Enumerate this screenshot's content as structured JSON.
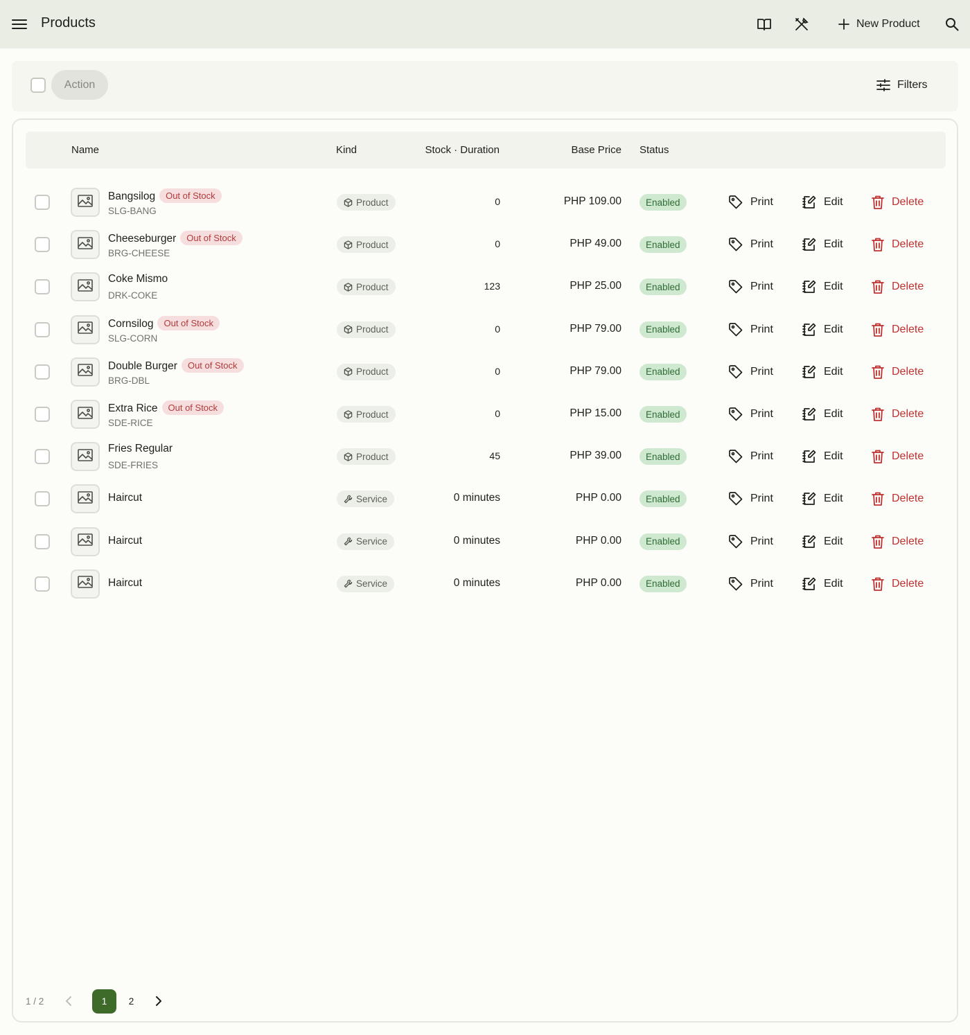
{
  "header": {
    "title": "Products",
    "new_product_label": "New Product",
    "icons": [
      "menu-icon",
      "book-icon",
      "tools-icon",
      "plus-icon",
      "search-icon"
    ]
  },
  "toolbar": {
    "action_label": "Action",
    "filters_label": "Filters"
  },
  "table": {
    "columns": [
      "Name",
      "Kind",
      "Stock · Duration",
      "Base Price",
      "Status"
    ],
    "actions": {
      "print": "Print",
      "edit": "Edit",
      "delete": "Delete"
    },
    "rows": [
      {
        "name": "Bangsilog",
        "badge": "Out of Stock",
        "sku": "SLG-BANG",
        "kind": "Product",
        "stock": "0",
        "price": "PHP 109.00",
        "status": "Enabled"
      },
      {
        "name": "Cheeseburger",
        "badge": "Out of Stock",
        "sku": "BRG-CHEESE",
        "kind": "Product",
        "stock": "0",
        "price": "PHP 49.00",
        "status": "Enabled"
      },
      {
        "name": "Coke Mismo",
        "badge": "",
        "sku": "DRK-COKE",
        "kind": "Product",
        "stock": "123",
        "price": "PHP 25.00",
        "status": "Enabled"
      },
      {
        "name": "Cornsilog",
        "badge": "Out of Stock",
        "sku": "SLG-CORN",
        "kind": "Product",
        "stock": "0",
        "price": "PHP 79.00",
        "status": "Enabled"
      },
      {
        "name": "Double Burger",
        "badge": "Out of Stock",
        "sku": "BRG-DBL",
        "kind": "Product",
        "stock": "0",
        "price": "PHP 79.00",
        "status": "Enabled"
      },
      {
        "name": "Extra Rice",
        "badge": "Out of Stock",
        "sku": "SDE-RICE",
        "kind": "Product",
        "stock": "0",
        "price": "PHP 15.00",
        "status": "Enabled"
      },
      {
        "name": "Fries Regular",
        "badge": "",
        "sku": "SDE-FRIES",
        "kind": "Product",
        "stock": "45",
        "price": "PHP 39.00",
        "status": "Enabled"
      },
      {
        "name": "Haircut",
        "badge": "",
        "sku": "",
        "kind": "Service",
        "stock": "0 minutes",
        "price": "PHP 0.00",
        "status": "Enabled"
      },
      {
        "name": "Haircut",
        "badge": "",
        "sku": "",
        "kind": "Service",
        "stock": "0 minutes",
        "price": "PHP 0.00",
        "status": "Enabled"
      },
      {
        "name": "Haircut",
        "badge": "",
        "sku": "",
        "kind": "Service",
        "stock": "0 minutes",
        "price": "PHP 0.00",
        "status": "Enabled"
      }
    ]
  },
  "pagination": {
    "info": "1 / 2",
    "pages": [
      "1",
      "2"
    ],
    "current": "1"
  },
  "colors": {
    "header_bg": "#e9ede3",
    "accent": "#3f6b2a",
    "danger": "#c23030",
    "enabled_bg": "#cfe8d0",
    "out_of_stock_bg": "#f7dede"
  }
}
